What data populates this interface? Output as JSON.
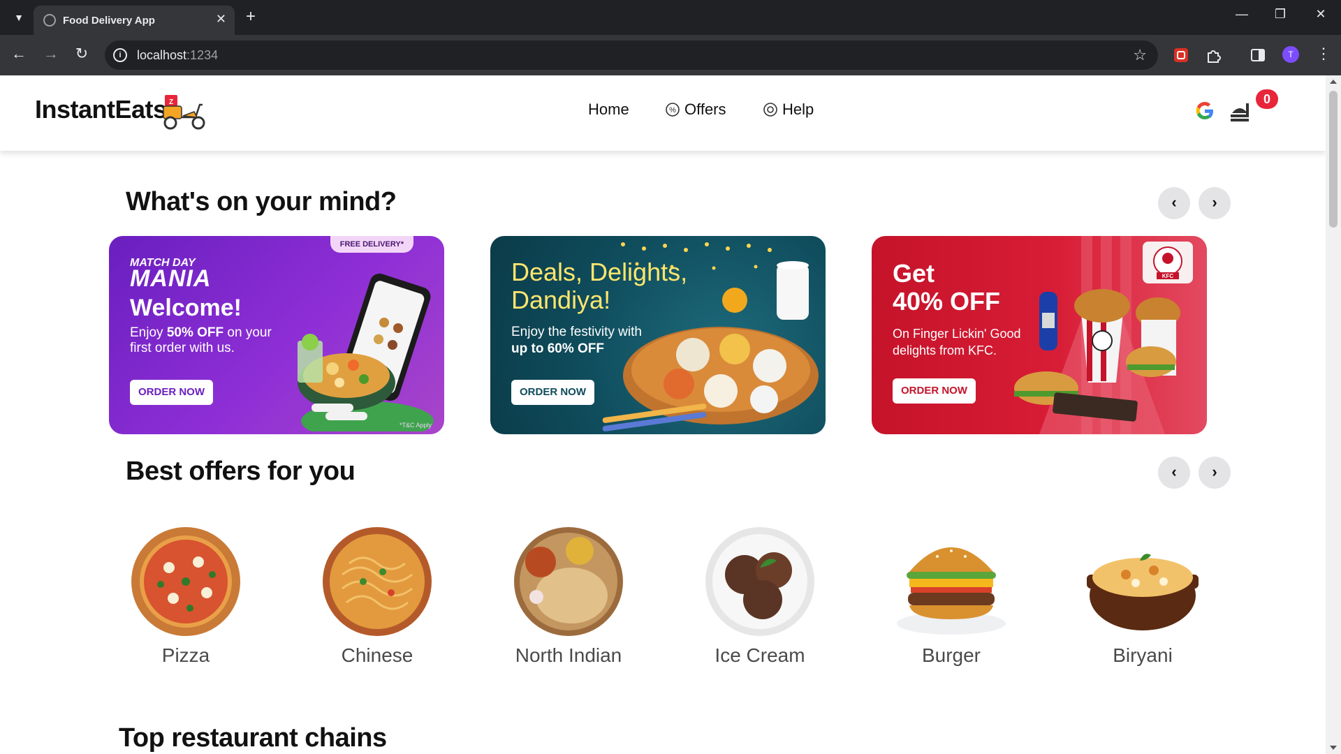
{
  "browser": {
    "tab_title": "Food Delivery App",
    "url_host": "localhost",
    "url_port": ":1234",
    "avatar_initial": "T"
  },
  "header": {
    "logo": "InstantEats",
    "nav": [
      {
        "label": "Home",
        "icon": ""
      },
      {
        "label": "Offers",
        "icon": "offers-icon"
      },
      {
        "label": "Help",
        "icon": "help-icon"
      }
    ],
    "cart_count": "0"
  },
  "sections": {
    "mind_title": "What's on your mind?",
    "offers_title": "Best offers for you",
    "chains_title": "Top restaurant chains"
  },
  "banners": [
    {
      "tag": "FREE DELIVERY*",
      "brand_top": "MATCH DAY",
      "brand": "MANIA",
      "headline": "Welcome!",
      "sub_pre": "Enjoy ",
      "sub_bold": "50% OFF",
      "sub_post": " on your first order with us.",
      "button": "ORDER NOW",
      "footnote": "*T&C Apply"
    },
    {
      "headline": "Deals, Delights, Dandiya!",
      "sub_pre": "Enjoy the festivity with",
      "sub_bold": "up to 60% OFF",
      "button": "ORDER NOW"
    },
    {
      "headline_1": "Get",
      "headline_2": "40% OFF",
      "sub": "On Finger Lickin' Good delights from KFC.",
      "button": "ORDER NOW",
      "logo": "KFC"
    }
  ],
  "categories": [
    {
      "label": "Pizza"
    },
    {
      "label": "Chinese"
    },
    {
      "label": "North Indian"
    },
    {
      "label": "Ice Cream"
    },
    {
      "label": "Burger"
    },
    {
      "label": "Biryani"
    }
  ],
  "colors": {
    "accent_red": "#e8253a",
    "banner_purple": "#6a1fbf",
    "banner_teal": "#0f4c5c",
    "banner_red": "#c5132a"
  }
}
